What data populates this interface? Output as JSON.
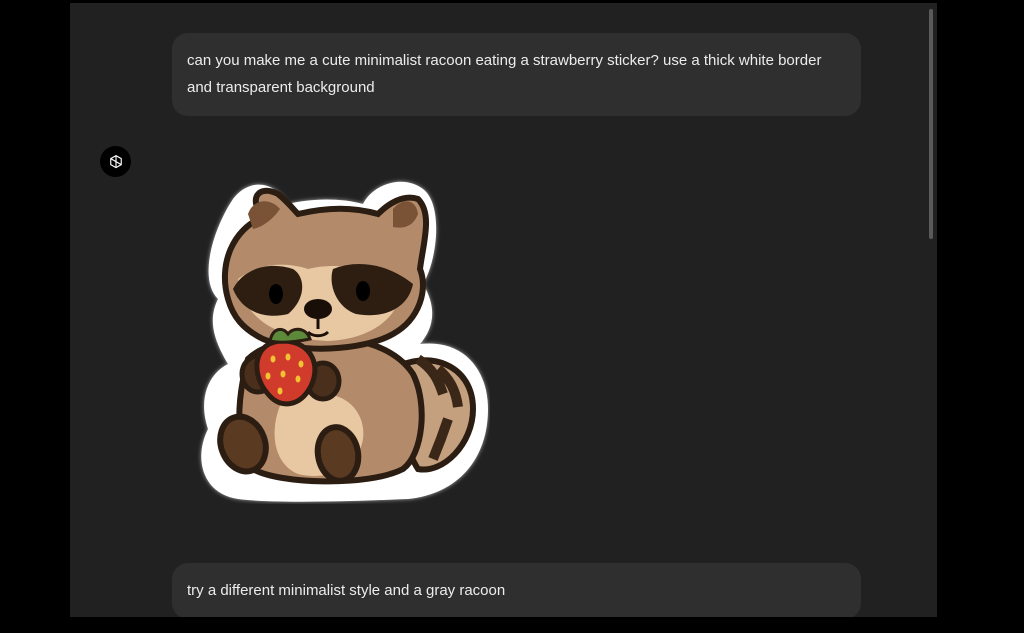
{
  "messages": [
    {
      "role": "user",
      "text": "can you make me a cute minimalist racoon eating a strawberry sticker? use a thick white border and transparent background"
    },
    {
      "role": "assistant",
      "content": "image",
      "image_alt": "sticker-raccoon-strawberry"
    },
    {
      "role": "user",
      "text": "try a different minimalist style and a gray racoon"
    }
  ],
  "icons": {
    "assistant_avatar": "openai-logo-icon"
  },
  "colors": {
    "bg": "#212121",
    "bubble": "#2f2f2f",
    "text": "#ececec"
  }
}
